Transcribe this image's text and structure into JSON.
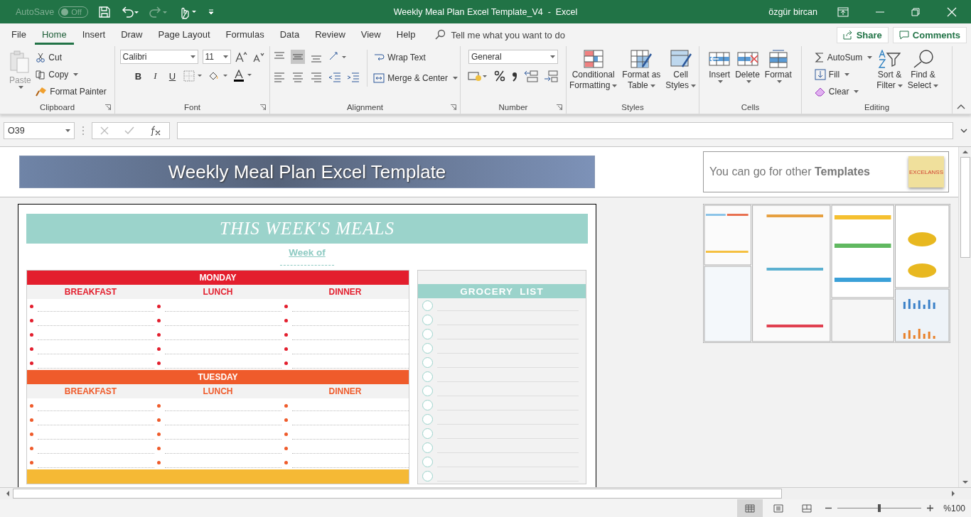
{
  "title_bar": {
    "autosave": "AutoSave",
    "autosave_toggle": {
      "label": "Off",
      "on": false
    },
    "title": "Weekly Meal Plan Excel Template_V4  -  Excel",
    "user": "özgür bircan"
  },
  "menu_tabs": [
    {
      "label": "File",
      "selected": false
    },
    {
      "label": "Home",
      "selected": true
    },
    {
      "label": "Insert",
      "selected": false
    },
    {
      "label": "Draw",
      "selected": false
    },
    {
      "label": "Page Layout",
      "selected": false
    },
    {
      "label": "Formulas",
      "selected": false
    },
    {
      "label": "Data",
      "selected": false
    },
    {
      "label": "Review",
      "selected": false
    },
    {
      "label": "View",
      "selected": false
    },
    {
      "label": "Help",
      "selected": false
    }
  ],
  "tell_me": "Tell me what you want to do",
  "share": "Share",
  "comments": "Comments",
  "ribbon": {
    "clipboard": {
      "label": "Clipboard",
      "paste": "Paste",
      "cut": "Cut",
      "copy": "Copy",
      "format_painter": "Format Painter"
    },
    "font": {
      "label": "Font",
      "font_name": "Calibri",
      "font_size": "11",
      "bold": "B",
      "italic": "I",
      "underline": "U"
    },
    "alignment": {
      "label": "Alignment",
      "wrap": "Wrap Text",
      "merge": "Merge & Center"
    },
    "number": {
      "label": "Number",
      "format": "General"
    },
    "styles": {
      "label": "Styles",
      "buttons": [
        {
          "kind": "conditional",
          "line1": "Conditional",
          "line2": "Formatting"
        },
        {
          "kind": "table",
          "line1": "Format as",
          "line2": "Table"
        },
        {
          "kind": "cell",
          "line1": "Cell",
          "line2": "Styles"
        }
      ]
    },
    "cells": {
      "label": "Cells",
      "buttons": [
        {
          "kind": "insert",
          "label": "Insert"
        },
        {
          "kind": "delete",
          "label": "Delete"
        },
        {
          "kind": "format",
          "label": "Format"
        }
      ]
    },
    "editing": {
      "label": "Editing",
      "autosum": "AutoSum",
      "fill": "Fill",
      "clear": "Clear",
      "sort": [
        "Sort &",
        "Filter"
      ],
      "find": [
        "Find &",
        "Select"
      ]
    }
  },
  "formula_bar": {
    "name_box": "O39"
  },
  "sheet": {
    "banner": "Weekly Meal Plan Excel Template",
    "promo": "You can go for other **Templates**",
    "logo": "EXCELANSS",
    "meals": {
      "title": "THIS WEEK'S MEALS",
      "week_of": "Week of",
      "days": [
        {
          "name": "MONDAY",
          "color": "#e31e2d",
          "meals": [
            "BREAKFAST",
            "LUNCH",
            "DINNER"
          ]
        },
        {
          "name": "TUESDAY",
          "color": "#ef5b2b",
          "meals": [
            "BREAKFAST",
            "LUNCH",
            "DINNER"
          ]
        },
        {
          "color": "#f5b935"
        }
      ]
    },
    "grocery": {
      "title": "GROCERY  LIST"
    }
  },
  "status_bar": {
    "views": [
      {
        "kind": "normal",
        "selected": true
      },
      {
        "kind": "page_layout",
        "selected": false
      },
      {
        "kind": "page_break",
        "selected": false
      }
    ],
    "zoom": {
      "level": 0.5,
      "label": "%100"
    }
  }
}
